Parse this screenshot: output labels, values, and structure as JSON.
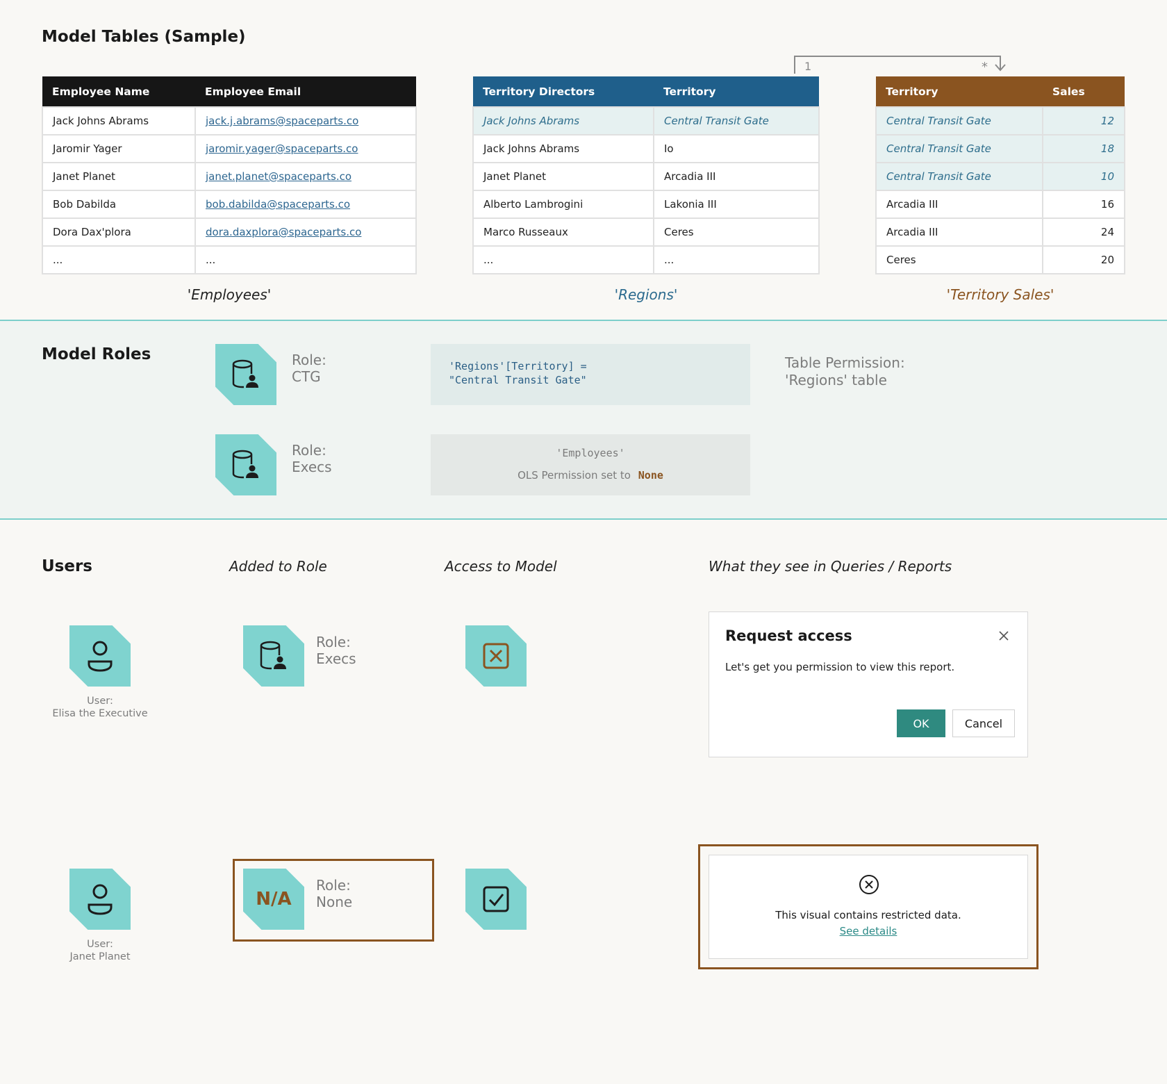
{
  "tables_section": {
    "title": "Model Tables (Sample)",
    "relationship": {
      "one": "1",
      "many": "*"
    },
    "employees": {
      "caption": "'Employees'",
      "columns": [
        "Employee Name",
        "Employee Email"
      ],
      "rows": [
        [
          "Jack Johns Abrams",
          "jack.j.abrams@spaceparts.co"
        ],
        [
          "Jaromir Yager",
          "jaromir.yager@spaceparts.co"
        ],
        [
          "Janet Planet",
          "janet.planet@spaceparts.co"
        ],
        [
          "Bob Dabilda",
          "bob.dabilda@spaceparts.co"
        ],
        [
          "Dora Dax'plora",
          "dora.daxplora@spaceparts.co"
        ],
        [
          "...",
          "..."
        ]
      ]
    },
    "regions": {
      "caption": "'Regions'",
      "columns": [
        "Territory Directors",
        "Territory"
      ],
      "rows": [
        [
          "Jack Johns Abrams",
          "Central Transit Gate"
        ],
        [
          "Jack Johns Abrams",
          "Io"
        ],
        [
          "Janet Planet",
          "Arcadia III"
        ],
        [
          "Alberto Lambrogini",
          "Lakonia III"
        ],
        [
          "Marco Russeaux",
          "Ceres"
        ],
        [
          "...",
          "..."
        ]
      ]
    },
    "territory_sales": {
      "caption": "'Territory Sales'",
      "columns": [
        "Territory",
        "Sales"
      ],
      "rows": [
        [
          "Central Transit Gate",
          "12"
        ],
        [
          "Central Transit Gate",
          "18"
        ],
        [
          "Central Transit Gate",
          "10"
        ],
        [
          "Arcadia III",
          "16"
        ],
        [
          "Arcadia III",
          "24"
        ],
        [
          "Ceres",
          "20"
        ]
      ]
    }
  },
  "roles_section": {
    "title": "Model Roles",
    "role_ctg": {
      "label": "Role:",
      "name": "CTG",
      "rls_line1": "'Regions'[Territory] =",
      "rls_line2": "\"Central Transit Gate\""
    },
    "table_permission": {
      "line1": "Table Permission:",
      "line2": "'Regions' table"
    },
    "role_execs": {
      "label": "Role:",
      "name": "Execs",
      "ols_table": "'Employees'",
      "ols_text": "OLS Permission set to",
      "ols_value": "None"
    }
  },
  "users_section": {
    "title": "Users",
    "col_added": "Added to Role",
    "col_access": "Access to Model",
    "col_see": "What they see in Queries / Reports",
    "user1": {
      "label": "User:",
      "name": "Elisa the Executive",
      "role_label": "Role:",
      "role_name": "Execs"
    },
    "user2": {
      "label": "User:",
      "name": "Janet Planet",
      "na": "N/A",
      "role_label": "Role:",
      "role_name": "None"
    },
    "dialog": {
      "title": "Request access",
      "text": "Let's get you permission to view this report.",
      "ok": "OK",
      "cancel": "Cancel"
    },
    "restricted": {
      "message": "This visual contains restricted data.",
      "link": "See details"
    }
  },
  "colors": {
    "accent_teal": "#7fd3cf",
    "brown": "#8a5420",
    "region_blue": "#1f5f8b",
    "ok_green": "#2f8a80"
  }
}
